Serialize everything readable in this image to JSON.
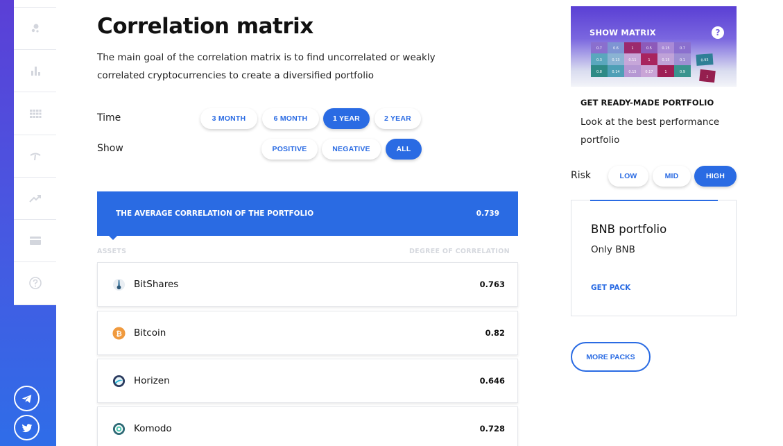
{
  "header": {
    "title": "Correlation matrix",
    "description": "The main goal of the correlation matrix is to find uncorrelated or weakly correlated cryptocurrencies to create a diversified portfolio"
  },
  "filters": {
    "time_label": "Time",
    "time_options": [
      "3 MONTH",
      "6 MONTH",
      "1 YEAR",
      "2 YEAR"
    ],
    "time_selected": "1 YEAR",
    "show_label": "Show",
    "show_options": [
      "POSITIVE",
      "NEGATIVE",
      "ALL"
    ],
    "show_selected": "ALL"
  },
  "summary": {
    "label": "THE AVERAGE CORRELATION OF THE PORTFOLIO",
    "value": "0.739"
  },
  "table": {
    "col_assets": "ASSETS",
    "col_degree": "DEGREE OF CORRELATION",
    "rows": [
      {
        "name": "BitShares",
        "value": "0.763",
        "icon": "bitshares-icon"
      },
      {
        "name": "Bitcoin",
        "value": "0.82",
        "icon": "bitcoin-icon"
      },
      {
        "name": "Horizen",
        "value": "0.646",
        "icon": "horizen-icon"
      },
      {
        "name": "Komodo",
        "value": "0.728",
        "icon": "komodo-icon"
      }
    ]
  },
  "matrix_card": {
    "title": "SHOW MATRIX",
    "help": "?",
    "cells": [
      [
        "0.7",
        "0.6",
        "1",
        "0.5",
        "0.15",
        "0.7"
      ],
      [
        "0.3",
        "0.13",
        "0.11",
        "1",
        "0.15",
        "0.1"
      ],
      [
        "0.8",
        "0.14",
        "0.15",
        "0.17",
        "1",
        "0.9"
      ]
    ],
    "floating": [
      "0.93",
      "1"
    ]
  },
  "ready": {
    "title": "GET READY-MADE PORTFOLIO",
    "description": "Look at the best performance portfolio"
  },
  "risk": {
    "label": "Risk",
    "options": [
      "LOW",
      "MID",
      "HIGH"
    ],
    "selected": "HIGH"
  },
  "pack": {
    "name": "BNB portfolio",
    "subtitle": "Only BNB",
    "link": "GET PACK"
  },
  "more_packs": "MORE PACKS",
  "colors": {
    "accent": "#2a6be3",
    "band_top": "#5b3fd6",
    "band_bottom": "#2f6de8"
  }
}
